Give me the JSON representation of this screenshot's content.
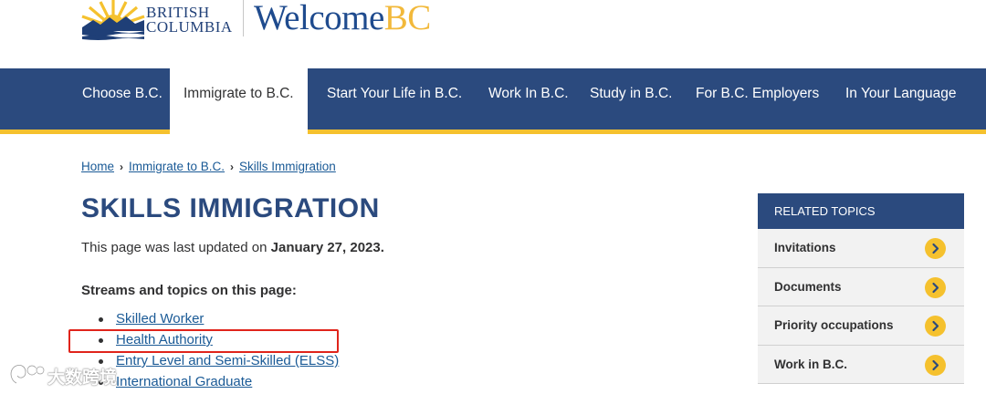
{
  "brand": {
    "logo_text_line1": "BRITISH",
    "logo_text_line2": "COLUMBIA",
    "site_name_main": "Welcome",
    "site_name_accent": "BC"
  },
  "colors": {
    "nav_bg": "#2b4a7e",
    "accent_yellow": "#f5c12e",
    "link_blue": "#1a5a96",
    "highlight_red": "#e0241b"
  },
  "nav": {
    "items": [
      {
        "label": "Choose B.C."
      },
      {
        "label": "Immigrate to B.C.",
        "active": true
      },
      {
        "label": "Start Your Life in B.C."
      },
      {
        "label": "Work In B.C."
      },
      {
        "label": "Study in B.C."
      },
      {
        "label": "For B.C. Employers"
      },
      {
        "label": "In Your Language"
      }
    ]
  },
  "breadcrumb": {
    "items": [
      "Home",
      "Immigrate to B.C.",
      "Skills Immigration"
    ]
  },
  "main": {
    "title": "SKILLS IMMIGRATION",
    "updated_prefix": "This page was last updated on ",
    "updated_date": "January 27, 2023.",
    "streams_heading": "Streams and topics on this page:",
    "streams": [
      "Skilled Worker",
      "Health Authority",
      "Entry Level and Semi-Skilled (ELSS)",
      "International Graduate"
    ]
  },
  "related": {
    "header": "RELATED TOPICS",
    "items": [
      "Invitations",
      "Documents",
      "Priority occupations",
      "Work in B.C."
    ]
  },
  "watermark": {
    "text": "大数跨境"
  }
}
